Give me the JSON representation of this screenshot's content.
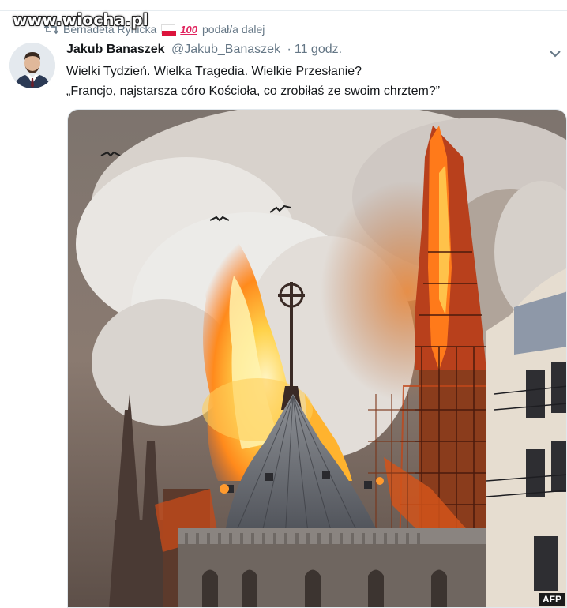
{
  "watermark": {
    "text": "www.wiocha.pl"
  },
  "retweet": {
    "user": "Bernadeta Rynicka",
    "emoji": "100",
    "action": "podał/a dalej",
    "icon": "retweet-icon"
  },
  "tweet": {
    "author_name": "Jakub Banaszek",
    "author_handle": "@Jakub_Banaszek",
    "separator": "·",
    "time": "11 godz.",
    "text_line1": "Wielki Tydzień. Wielka Tragedia. Wielkie Przesłanie?",
    "text_line2": "„Francjo, najstarsza córo Kościoła, co zrobiłaś ze swoim chrztem?”"
  },
  "media": {
    "credit": "AFP"
  },
  "colors": {
    "secondary_text": "#657786",
    "flag_white": "#ffffff",
    "flag_red": "#dc143c",
    "fire": "#ff8c1a",
    "smoke": "#e8e4e0"
  }
}
